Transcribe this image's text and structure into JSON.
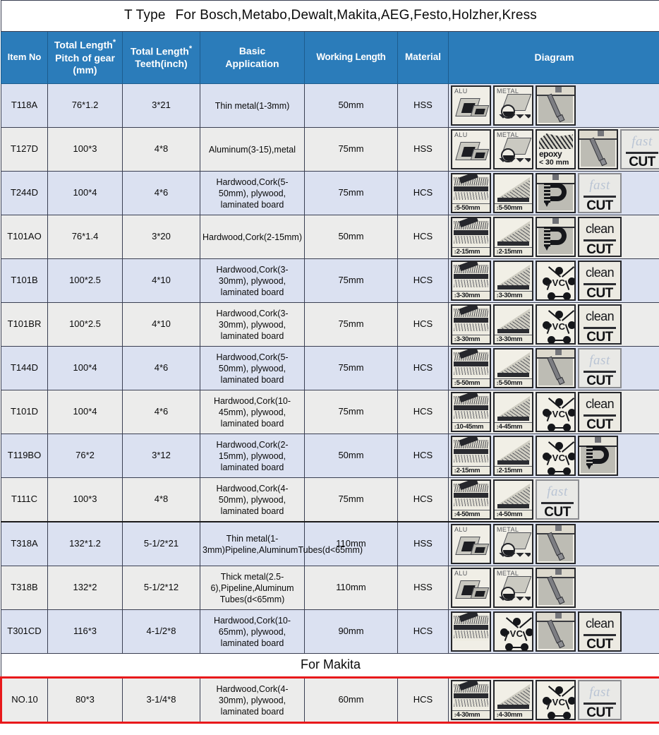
{
  "title": {
    "prefix": "T Type",
    "text": "For Bosch,Metabo,Dewalt,Makita,AEG,Festo,Holzher,Kress"
  },
  "colors": {
    "header_blue": "#2b7cba",
    "band_a": "#dbe1f1",
    "band_b": "#ececeb",
    "highlight_red": "#e8191b"
  },
  "header": {
    "item_no": "Item No",
    "total_length_pitch_l1": "Total Length",
    "total_length_pitch_l2": "Pitch of gear",
    "total_length_pitch_l3": "(mm)",
    "total_length_teeth_l1": "Total Length",
    "total_length_teeth_l2": "Teeth(inch)",
    "basic_application_l1": "Basic",
    "basic_application_l2": "Application",
    "working_length": "Working Length",
    "material": "Material",
    "diagram": "Diagram"
  },
  "section_makita": "For Makita",
  "rows": [
    {
      "item": "T118A",
      "pitch": "76*1.2",
      "teeth": "3*21",
      "app": "Thin metal(1-3mm)",
      "work": "50mm",
      "mat": "HSS",
      "icons": [
        {
          "type": "alu",
          "tag": "ALU"
        },
        {
          "type": "metal",
          "tag": "METAL"
        },
        {
          "type": "slot"
        }
      ]
    },
    {
      "item": "T127D",
      "pitch": "100*3",
      "teeth": "4*8",
      "app": "Aluminum(3-15),metal",
      "work": "75mm",
      "mat": "HSS",
      "icons": [
        {
          "type": "alu",
          "tag": "ALU"
        },
        {
          "type": "metal",
          "tag": "METAL"
        },
        {
          "type": "epoxy",
          "w1": "epoxy",
          "w2": "< 30 mm"
        },
        {
          "type": "slot"
        },
        {
          "type": "badge",
          "top": "fast",
          "bottom": "CUT",
          "style": "faint"
        }
      ]
    },
    {
      "item": "T244D",
      "pitch": "100*4",
      "teeth": "4*6",
      "app": "Hardwood,Cork(5-50mm), plywood, laminated board",
      "work": "75mm",
      "mat": "HCS",
      "icons": [
        {
          "type": "wood",
          "label": "5-50mm"
        },
        {
          "type": "wedge",
          "label": "5-50mm"
        },
        {
          "type": "screw"
        },
        {
          "type": "badge",
          "top": "fast",
          "bottom": "CUT",
          "style": "faint"
        }
      ]
    },
    {
      "item": "T101AO",
      "pitch": "76*1.4",
      "teeth": "3*20",
      "app": "Hardwood,Cork(2-15mm)",
      "work": "50mm",
      "mat": "HCS",
      "icons": [
        {
          "type": "wood",
          "label": "2-15mm"
        },
        {
          "type": "wedge",
          "label": "2-15mm"
        },
        {
          "type": "screw"
        },
        {
          "type": "badge",
          "top": "clean",
          "bottom": "CUT",
          "style": "solid"
        }
      ]
    },
    {
      "item": "T101B",
      "pitch": "100*2.5",
      "teeth": "4*10",
      "app": "Hardwood,Cork(3-30mm), plywood, laminated board",
      "work": "75mm",
      "mat": "HCS",
      "icons": [
        {
          "type": "wood",
          "label": "3-30mm"
        },
        {
          "type": "wedge",
          "label": "3-30mm"
        },
        {
          "type": "pvc",
          "text": "PVC"
        },
        {
          "type": "badge",
          "top": "clean",
          "bottom": "CUT",
          "style": "solid"
        }
      ]
    },
    {
      "item": "T101BR",
      "pitch": "100*2.5",
      "teeth": "4*10",
      "app": "Hardwood,Cork(3-30mm), plywood, laminated board",
      "work": "75mm",
      "mat": "HCS",
      "icons": [
        {
          "type": "wood",
          "label": "3-30mm"
        },
        {
          "type": "wedge",
          "label": "3-30mm"
        },
        {
          "type": "pvc",
          "text": "PVC"
        },
        {
          "type": "badge",
          "top": "clean",
          "bottom": "CUT",
          "style": "solid"
        }
      ]
    },
    {
      "item": "T144D",
      "pitch": "100*4",
      "teeth": "4*6",
      "app": "Hardwood,Cork(5-50mm), plywood, laminated board",
      "work": "75mm",
      "mat": "HCS",
      "icons": [
        {
          "type": "wood",
          "label": "5-50mm"
        },
        {
          "type": "wedge",
          "label": "5-50mm"
        },
        {
          "type": "slot"
        },
        {
          "type": "badge",
          "top": "fast",
          "bottom": "CUT",
          "style": "faint"
        }
      ]
    },
    {
      "item": "T101D",
      "pitch": "100*4",
      "teeth": "4*6",
      "app": "Hardwood,Cork(10-45mm), plywood, laminated board",
      "work": "75mm",
      "mat": "HCS",
      "icons": [
        {
          "type": "wood",
          "label": "10-45mm"
        },
        {
          "type": "wedge",
          "label": "4-45mm"
        },
        {
          "type": "pvc",
          "text": "PVC"
        },
        {
          "type": "badge",
          "top": "clean",
          "bottom": "CUT",
          "style": "solid"
        }
      ]
    },
    {
      "item": "T119BO",
      "pitch": "76*2",
      "teeth": "3*12",
      "app": "Hardwood,Cork(2-15mm), plywood, laminated board",
      "work": "50mm",
      "mat": "HCS",
      "icons": [
        {
          "type": "wood",
          "label": "2-15mm"
        },
        {
          "type": "wedge",
          "label": "2-15mm"
        },
        {
          "type": "pvc",
          "text": "PVC"
        },
        {
          "type": "screw"
        }
      ]
    },
    {
      "item": "T111C",
      "pitch": "100*3",
      "teeth": "4*8",
      "app": "Hardwood,Cork(4-50mm), plywood, laminated board",
      "work": "75mm",
      "mat": "HCS",
      "icons": [
        {
          "type": "wood",
          "label": "4-50mm"
        },
        {
          "type": "wedge",
          "label": "4-50mm"
        },
        {
          "type": "badge",
          "top": "fast",
          "bottom": "CUT",
          "style": "faint"
        }
      ]
    },
    {
      "item": "T318A",
      "pitch": "132*1.2",
      "teeth": "5-1/2*21",
      "app": "Thin metal(1-3mm)Pipeline,AluminumTubes(d<65mm)",
      "work": "110mm",
      "mat": "HSS",
      "group_top": true,
      "icons": [
        {
          "type": "alu",
          "tag": "ALU"
        },
        {
          "type": "metal",
          "tag": "METAL"
        },
        {
          "type": "slot"
        }
      ]
    },
    {
      "item": "T318B",
      "pitch": "132*2",
      "teeth": "5-1/2*12",
      "app": "Thick metal(2.5-6),Pipeline,Aluminum Tubes(d<65mm)",
      "work": "110mm",
      "mat": "HSS",
      "icons": [
        {
          "type": "alu",
          "tag": "ALU"
        },
        {
          "type": "metal",
          "tag": "METAL"
        },
        {
          "type": "slot"
        }
      ]
    },
    {
      "item": "T301CD",
      "pitch": "116*3",
      "teeth": "4-1/2*8",
      "app": "Hardwood,Cork(10-65mm), plywood, laminated board",
      "work": "90mm",
      "mat": "HCS",
      "icons": [
        {
          "type": "wood"
        },
        {
          "type": "pvc",
          "text": "PVC"
        },
        {
          "type": "slot"
        },
        {
          "type": "badge",
          "top": "clean",
          "bottom": "CUT",
          "style": "solid"
        }
      ]
    },
    {
      "item": "NO.10",
      "pitch": "80*3",
      "teeth": "3-1/4*8",
      "app": "Hardwood,Cork(4-30mm), plywood, laminated board",
      "work": "60mm",
      "mat": "HCS",
      "highlight": true,
      "icons": [
        {
          "type": "wood",
          "label": "4-30mm"
        },
        {
          "type": "wedge",
          "label": "4-30mm"
        },
        {
          "type": "pvc",
          "text": "PVC"
        },
        {
          "type": "badge",
          "top": "fast",
          "bottom": "CUT",
          "style": "faint"
        }
      ]
    }
  ]
}
